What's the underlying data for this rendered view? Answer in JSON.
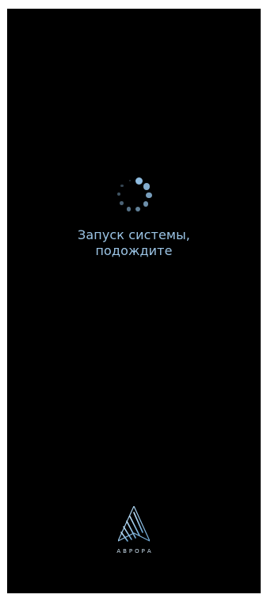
{
  "screen": {
    "background_color": "#000000",
    "accent_color": "#9cc5e6"
  },
  "loading": {
    "indicator": "spinner-icon",
    "status_line_1": "Запуск системы,",
    "status_line_2": "подождите"
  },
  "branding": {
    "logo_icon": "aurora-logo-icon",
    "brand_name": "АВРОРА"
  }
}
